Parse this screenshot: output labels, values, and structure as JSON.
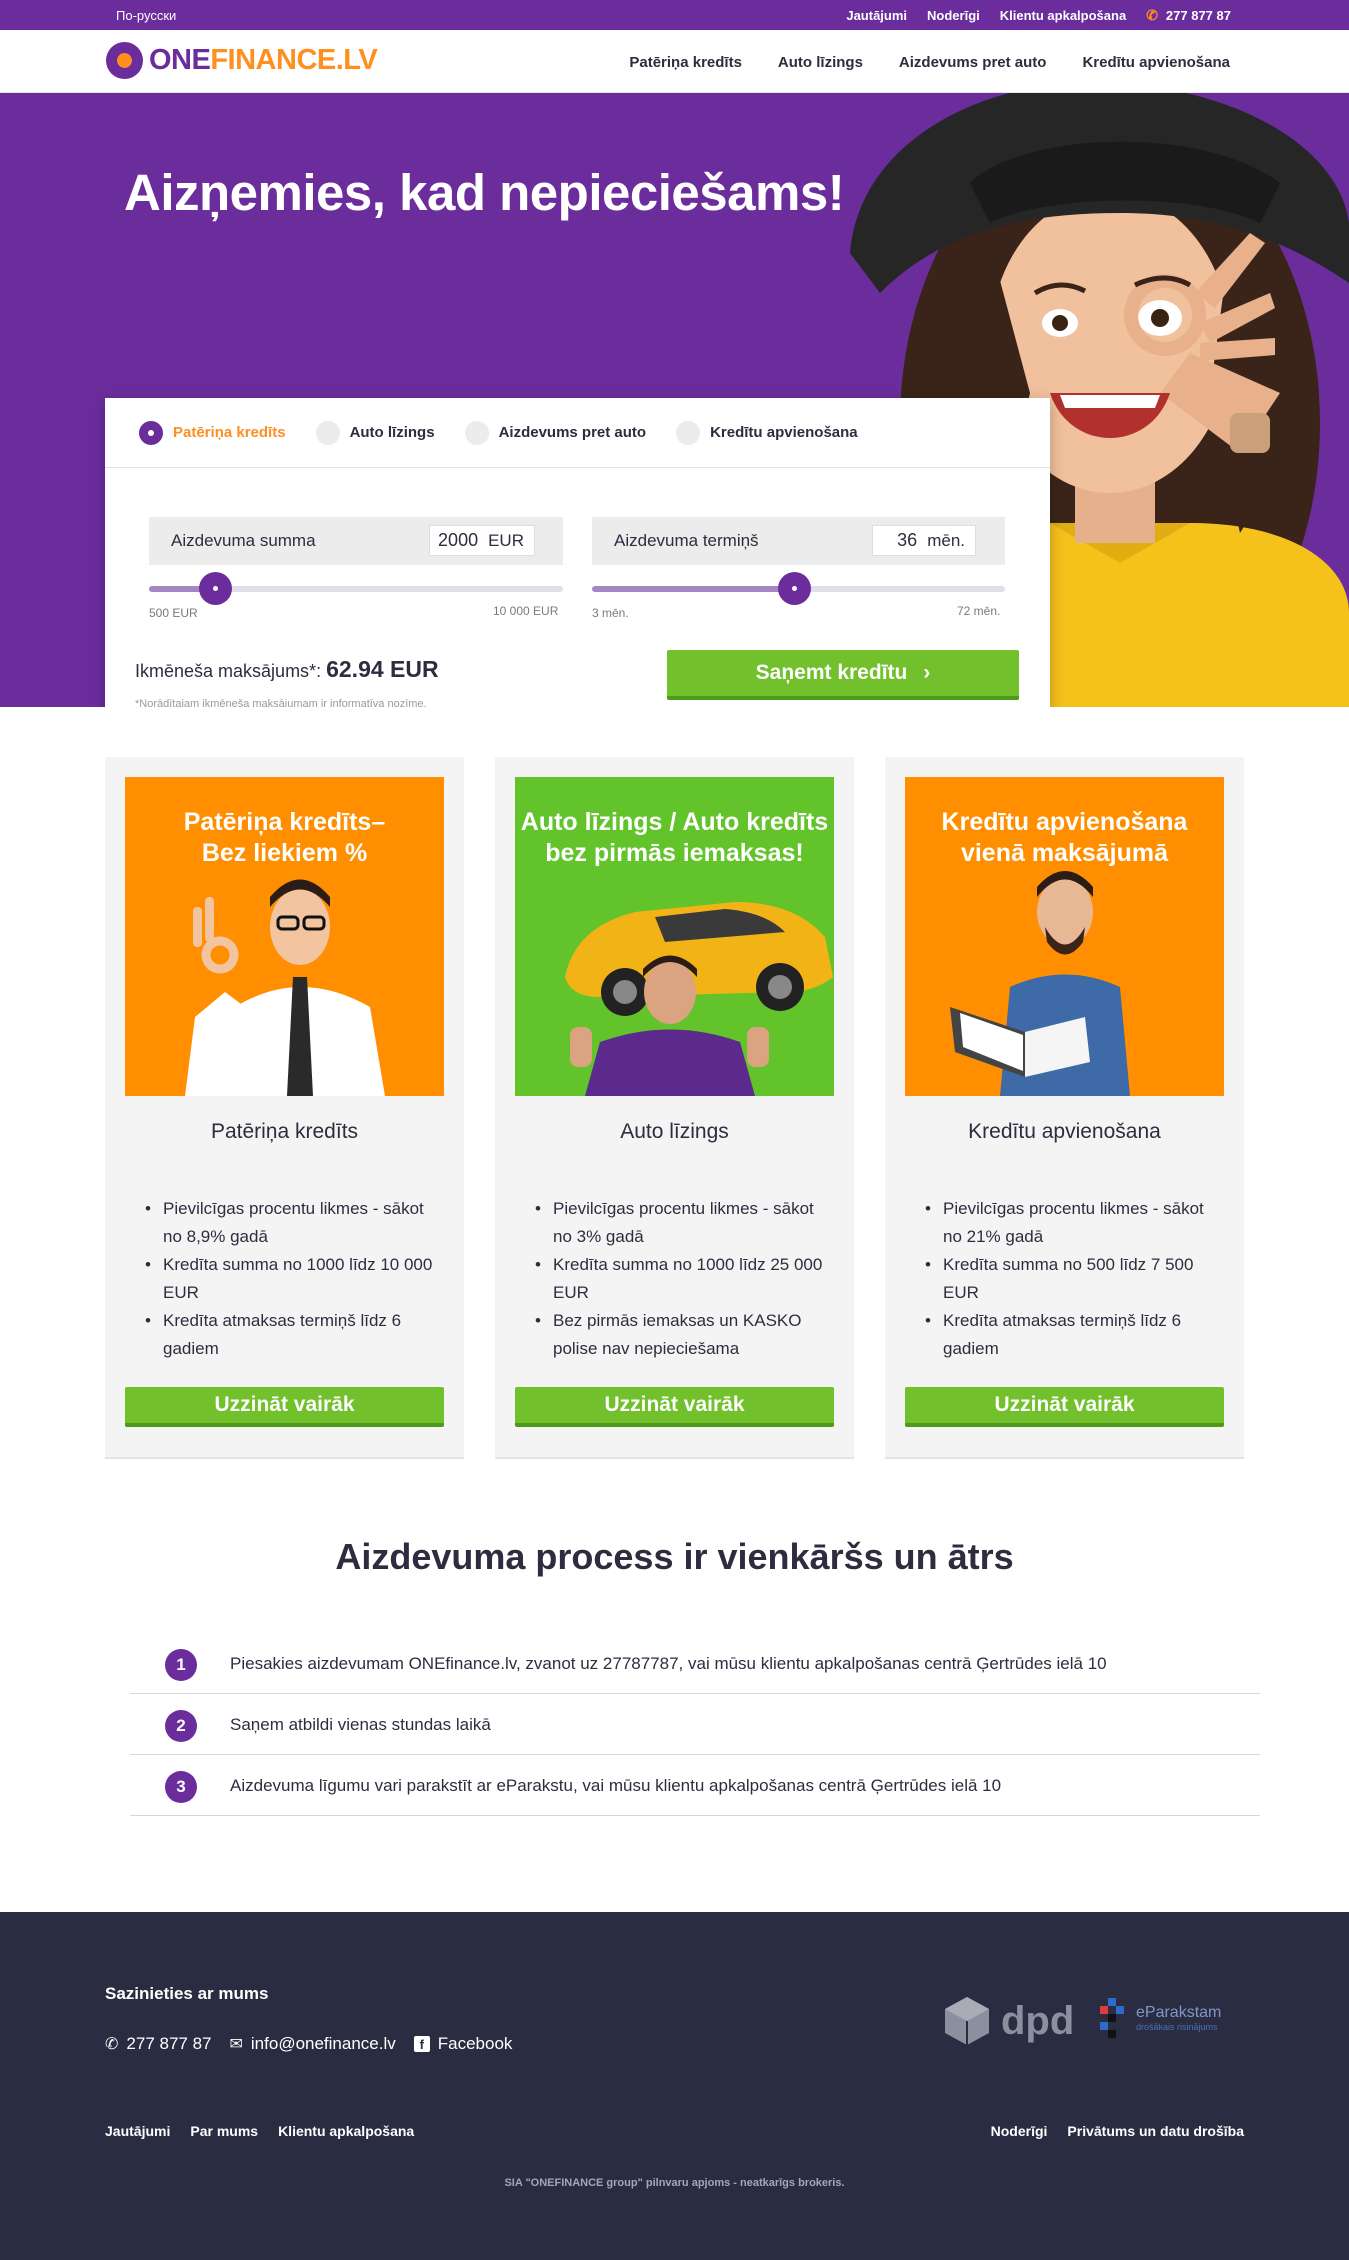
{
  "topbar": {
    "language": "По-русски",
    "links": [
      "Jautājumi",
      "Noderīgi",
      "Klientu apkalpošana"
    ],
    "phone": "277 877 87"
  },
  "header": {
    "logo_one": "ONE",
    "logo_finance": "FINANCE.LV",
    "nav": [
      "Patēriņa kredīts",
      "Auto līzings",
      "Aizdevums pret auto",
      "Kredītu apvienošana"
    ]
  },
  "hero": {
    "title": "Aizņemies, kad nepieciešams!"
  },
  "calculator": {
    "tabs": [
      {
        "label": "Patēriņa kredīts",
        "selected": true
      },
      {
        "label": "Auto līzings",
        "selected": false
      },
      {
        "label": "Aizdevums pret auto",
        "selected": false
      },
      {
        "label": "Kredītu apvienošana",
        "selected": false
      }
    ],
    "amount": {
      "label": "Aizdevuma summa",
      "value": "2000",
      "unit": "EUR",
      "min": "500 EUR",
      "max": "10 000 EUR",
      "slider_fraction": 0.16
    },
    "term": {
      "label": "Aizdevuma termiņš",
      "value": "36",
      "unit": "mēn.",
      "min": "3 mēn.",
      "max": "72 mēn.",
      "slider_fraction": 0.49
    },
    "monthly_label": "Ikmēneša maksājums*:",
    "monthly_value": "62.94 EUR",
    "note": "*Norādītajam ikmēneša maksājumam ir informatīva nozīme.",
    "cta": "Saņemt kredītu",
    "cta_icon": "chevron-right-icon"
  },
  "products": [
    {
      "banner": "Patēriņa kredīts–\nBez liekiem %",
      "banner_color": "#ff8f00",
      "title": "Patēriņa kredīts",
      "bullets": [
        "Pievilcīgas procentu likmes - sākot no 8,9% gadā",
        "Kredīta summa no 1000 līdz 10 000 EUR",
        "Kredīta atmaksas termiņš līdz 6 gadiem"
      ],
      "button": "Uzzināt vairāk"
    },
    {
      "banner": "Auto līzings / Auto kredīts\nbez pirmās iemaksas!",
      "banner_color": "#63c32a",
      "title": "Auto līzings",
      "bullets": [
        "Pievilcīgas procentu likmes - sākot no 3% gadā",
        "Kredīta summa no 1000 līdz 25 000 EUR",
        "Bez pirmās iemaksas un KASKO polise nav nepieciešama"
      ],
      "button": "Uzzināt vairāk"
    },
    {
      "banner": "Kredītu apvienošana\nvienā maksājumā",
      "banner_color": "#ff8f00",
      "title": "Kredītu apvienošana",
      "bullets": [
        "Pievilcīgas procentu likmes - sākot no 21% gadā",
        "Kredīta summa no 500 līdz 7 500 EUR",
        "Kredīta atmaksas termiņš līdz 6 gadiem"
      ],
      "button": "Uzzināt vairāk"
    }
  ],
  "process": {
    "title": "Aizdevuma process ir vienkāršs un ātrs",
    "steps": [
      {
        "num": "1",
        "text": "Piesakies aizdevumam ONEfinance.lv, zvanot uz 27787787, vai mūsu klientu apkalpošanas centrā Ģertrūdes ielā 10"
      },
      {
        "num": "2",
        "text": "Saņem atbildi vienas stundas laikā"
      },
      {
        "num": "3",
        "text": "Aizdevuma līgumu vari parakstīt ar eParakstu, vai mūsu klientu apkalpošanas centrā Ģertrūdes ielā 10"
      }
    ]
  },
  "footer": {
    "heading": "Sazinieties ar mums",
    "phone": "277 877 87",
    "email": "info@onefinance.lv",
    "facebook": "Facebook",
    "dpd": "dpd",
    "eparakstam": "eParakstam",
    "eparakstam_sub": "drošākais risinājums",
    "links_left": [
      "Jautājumi",
      "Par mums",
      "Klientu apkalpošana"
    ],
    "links_right": [
      "Noderīgi",
      "Privātums un datu drošība"
    ],
    "legal": "SIA \"ONEFINANCE group\" pilnvaru apjoms - neatkarīgs brokeris."
  },
  "colors": {
    "purple": "#6b2d9c",
    "orange": "#ff8f1f",
    "green": "#72c02c",
    "footer": "#2a2d42"
  }
}
